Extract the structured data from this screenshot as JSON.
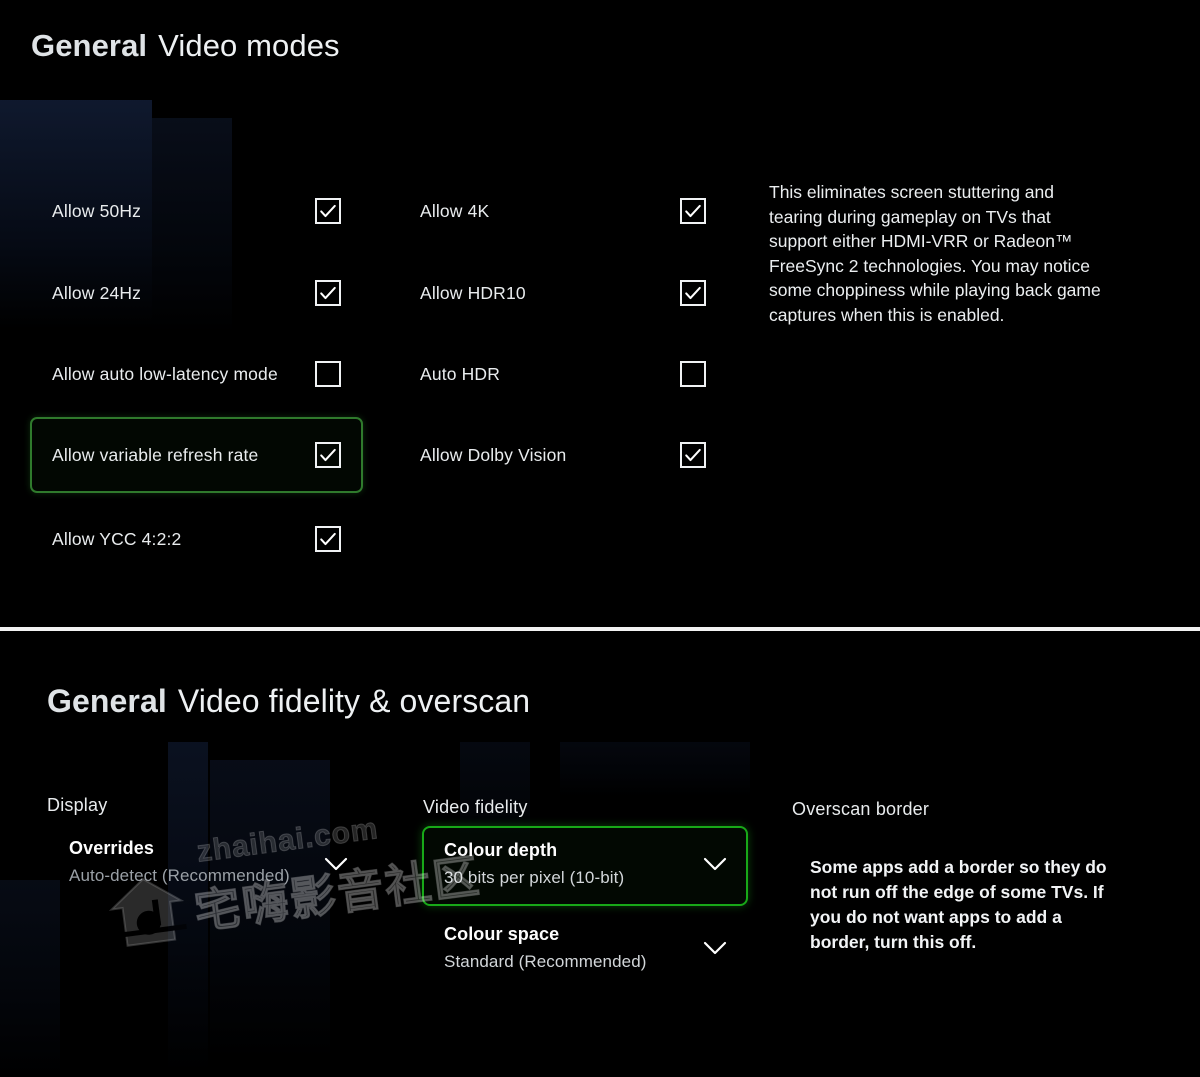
{
  "panels": {
    "video_modes": {
      "header_prefix": "General",
      "header_title": "Video modes",
      "left_column": [
        {
          "label": "Allow 50Hz",
          "checked": true
        },
        {
          "label": "Allow 24Hz",
          "checked": true
        },
        {
          "label": "Allow auto low-latency mode",
          "checked": false
        },
        {
          "label": "Allow variable refresh rate",
          "checked": true,
          "focused": true
        },
        {
          "label": "Allow YCC 4:2:2",
          "checked": true
        }
      ],
      "right_column": [
        {
          "label": "Allow 4K",
          "checked": true
        },
        {
          "label": "Allow HDR10",
          "checked": true
        },
        {
          "label": "Auto HDR",
          "checked": false
        },
        {
          "label": "Allow Dolby Vision",
          "checked": true
        }
      ],
      "description": "This eliminates screen stuttering and tearing during gameplay on TVs that support either HDMI-VRR or Radeon™ FreeSync 2 technologies. You may notice some choppiness while playing back game captures when this is enabled."
    },
    "video_fidelity": {
      "header_prefix": "General",
      "header_title": "Video fidelity & overscan",
      "display_group": {
        "title": "Display",
        "setting_label": "Overrides",
        "setting_value": "Auto-detect (Recommended)"
      },
      "fidelity_group": {
        "title": "Video fidelity",
        "colour_depth_label": "Colour depth",
        "colour_depth_value": "30 bits per pixel (10-bit)",
        "colour_space_label": "Colour space",
        "colour_space_value": "Standard (Recommended)"
      },
      "overscan_group": {
        "title": "Overscan border",
        "description": "Some apps add a border so they do not run off the edge of some TVs. If you do not want apps to add a border, turn this off."
      }
    }
  },
  "watermark": {
    "site_name": "宅嗨影音社区",
    "domain": "zhaihai.com"
  },
  "colors": {
    "background": "#000000",
    "text_primary": "#eef1f3",
    "focus_green_dim": "#2f7a2c",
    "focus_green_bright": "#18a818",
    "divider": "#f2f2f2"
  },
  "icons": {
    "checkmark": "check-icon",
    "chevron": "chevron-down-icon"
  }
}
